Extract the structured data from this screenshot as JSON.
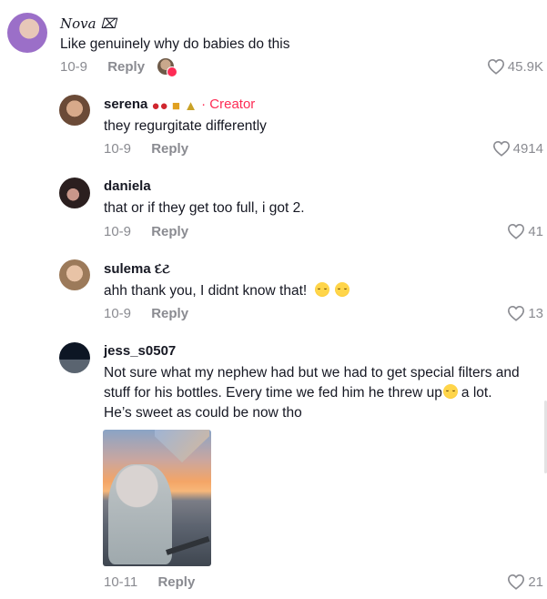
{
  "comments": [
    {
      "username": "Nova ⌧",
      "text": "Like genuinely why do babies do this",
      "date": "10-9",
      "reply_label": "Reply",
      "likes": "45.9K",
      "avatar_color": "#7b4db0"
    },
    {
      "username": "serena",
      "badge_icons": [
        "cherries-icon",
        "leopard-icon",
        "trophy-icon"
      ],
      "creator_label": "· Creator",
      "text": "they regurgitate differently",
      "date": "10-9",
      "reply_label": "Reply",
      "likes": "4914",
      "avatar_color": "#8a6a4f"
    },
    {
      "username": "daniela",
      "text": "that or if they get too full, i got 2.",
      "date": "10-9",
      "reply_label": "Reply",
      "likes": "41",
      "avatar_color": "#3a2a2a"
    },
    {
      "username": "sulema દટ",
      "text": "ahh thank you, I didnt know that!",
      "text_emojis": [
        "hugging-face-emoji",
        "hugging-face-emoji"
      ],
      "date": "10-9",
      "reply_label": "Reply",
      "likes": "13",
      "avatar_color": "#c9a27a"
    },
    {
      "username": "jess_s0507",
      "text_lines": [
        "Not sure what my nephew had but we had to get special filters and",
        "stuff for his bottles. Every time we fed him he threw up",
        "a lot.",
        "He’s sweet as could be now tho"
      ],
      "text_emoji": "pensive-face-emoji",
      "date": "10-11",
      "reply_label": "Reply",
      "likes": "21",
      "avatar_color": "#1e2a3a"
    }
  ],
  "liked_by_creator_indicator": "liked-by-creator-avatar",
  "colors": {
    "text_primary": "#161823",
    "text_secondary": "#8a8b91",
    "creator_accent": "#fe2c55"
  }
}
